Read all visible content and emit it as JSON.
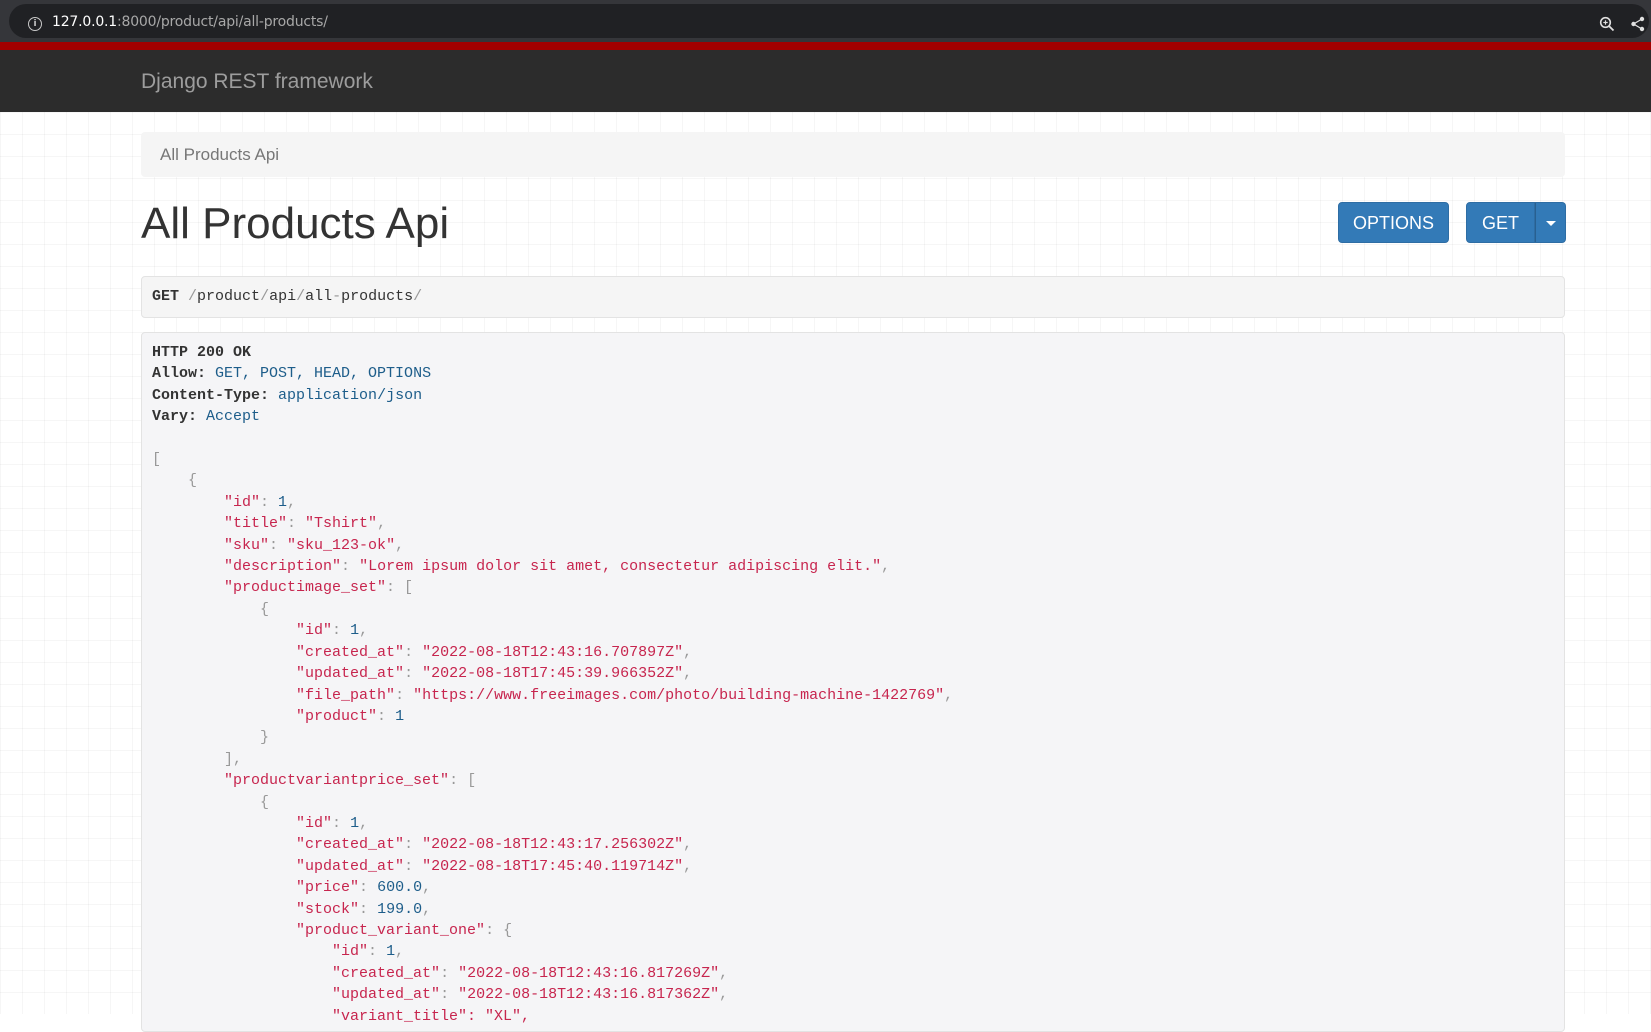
{
  "browser": {
    "url_host": "127.0.0.1",
    "url_path": ":8000/product/api/all-products/",
    "icons": [
      "info-icon",
      "zoom-icon",
      "share-icon"
    ]
  },
  "navbar": {
    "brand": "Django REST framework"
  },
  "breadcrumb": {
    "label": "All Products Api"
  },
  "page": {
    "title": "All Products Api"
  },
  "buttons": {
    "options": "OPTIONS",
    "get": "GET"
  },
  "request": {
    "method": "GET",
    "path_parts": [
      "product",
      "api",
      "all",
      "products"
    ]
  },
  "response": {
    "status": "HTTP 200 OK",
    "headers": {
      "allow_key": "Allow:",
      "allow_val": "GET, POST, HEAD, OPTIONS",
      "ctype_key": "Content-Type:",
      "ctype_val": "application/json",
      "vary_key": "Vary:",
      "vary_val": "Accept"
    },
    "body": {
      "id": "1",
      "title": "\"Tshirt\"",
      "sku": "\"sku_123-ok\"",
      "description": "\"Lorem ipsum dolor sit amet, consectetur adipiscing elit.\"",
      "image": {
        "id": "1",
        "created_at": "\"2022-08-18T12:43:16.707897Z\"",
        "updated_at": "\"2022-08-18T17:45:39.966352Z\"",
        "file_path": "\"https://www.freeimages.com/photo/building-machine-1422769\"",
        "product": "1"
      },
      "variant_price": {
        "id": "1",
        "created_at": "\"2022-08-18T12:43:17.256302Z\"",
        "updated_at": "\"2022-08-18T17:45:40.119714Z\"",
        "price": "600.0",
        "stock": "199.0",
        "variant_one": {
          "id": "1",
          "created_at": "\"2022-08-18T12:43:16.817269Z\"",
          "updated_at": "\"2022-08-18T12:43:16.817362Z\"",
          "variant_title_partial": "\"variant_title\": \"XL\","
        }
      }
    }
  }
}
